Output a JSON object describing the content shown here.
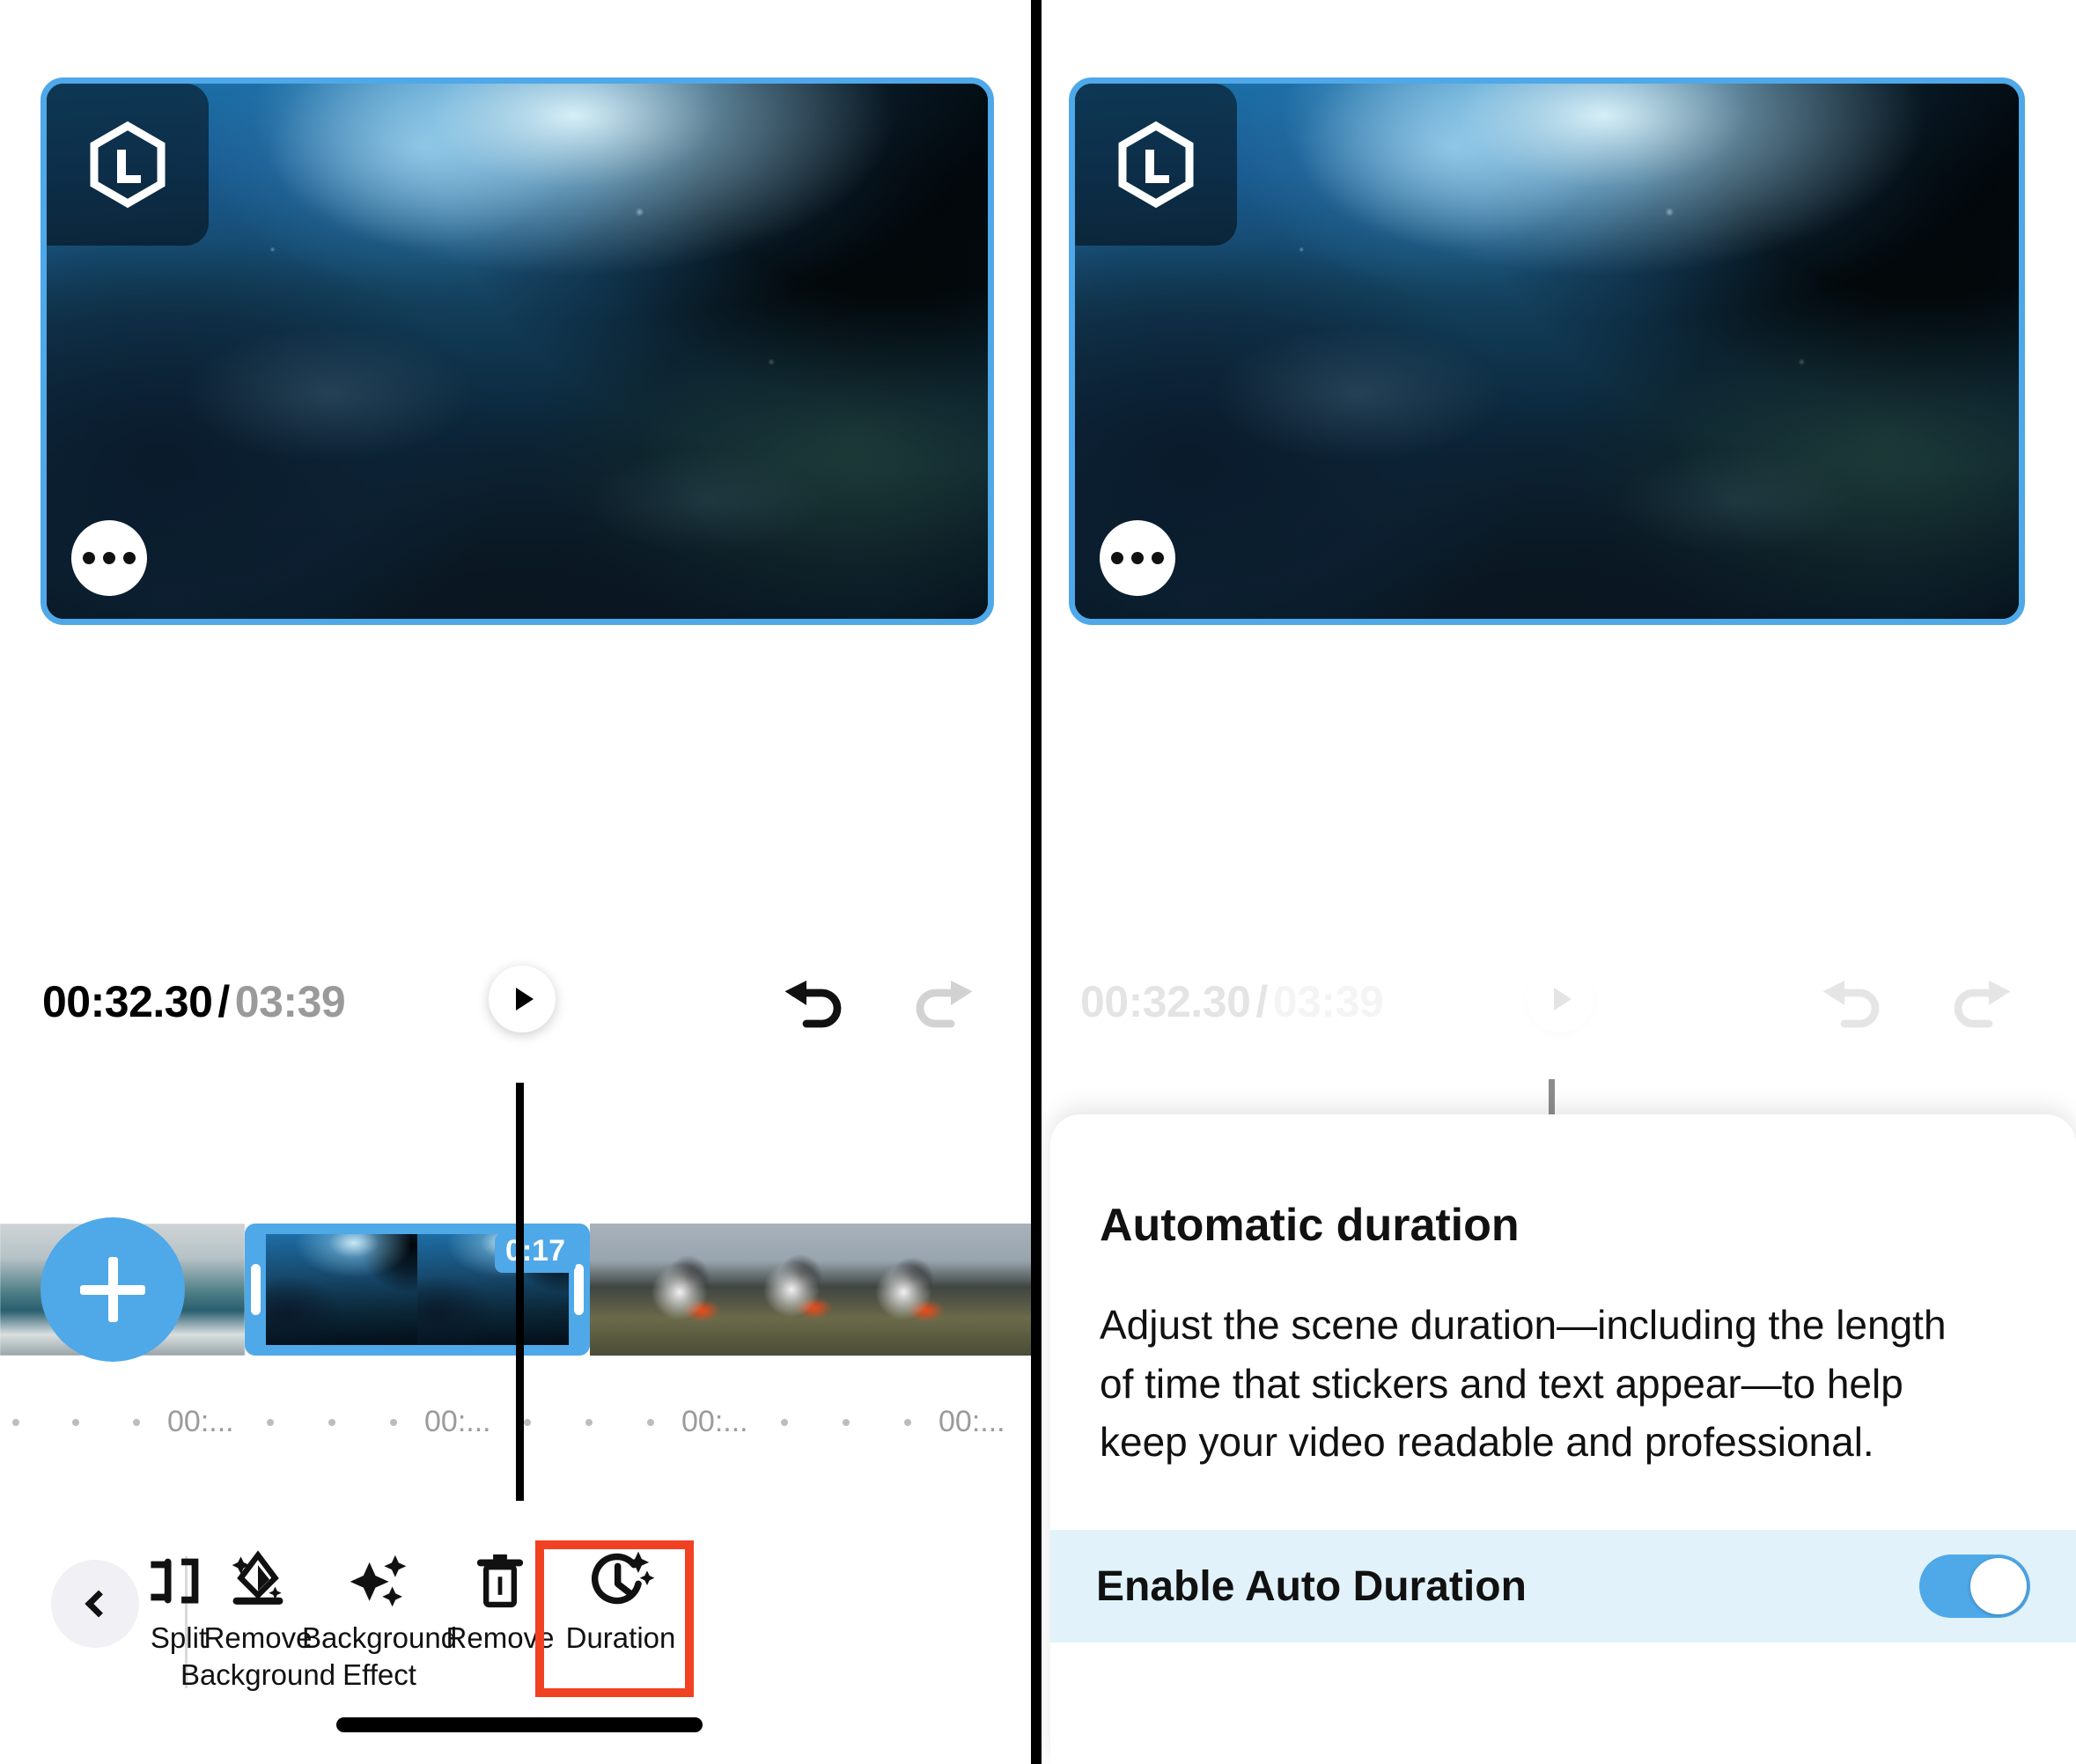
{
  "app": {
    "accent_blue": "#4FA8E8",
    "highlight_red": "#F04123",
    "row_highlight": "#E1F2FB"
  },
  "preview": {
    "watermark_letter": "L",
    "watermark_icon": "hexagon-l-logo",
    "more_icon": "ellipsis-icon"
  },
  "transport": {
    "current_time": "00:32.30",
    "separator": "/",
    "total_time": "03:39",
    "play_icon": "play-icon",
    "undo_icon": "undo-icon",
    "redo_icon": "redo-icon"
  },
  "timeline": {
    "add_label": "+",
    "add_icon": "plus-icon",
    "selected_clip_duration": "0:17",
    "ruler_labels": [
      "00:...",
      "00:...",
      "00:...",
      "00:..."
    ],
    "ruler_ticks": 8
  },
  "toolbar": {
    "back_icon": "chevron-left-icon",
    "items": [
      {
        "label": "Split",
        "icon": "split-icon",
        "highlighted": false
      },
      {
        "label": "Remove\nBackground",
        "line1": "Remove",
        "line2": "Background",
        "icon": "remove-background-icon",
        "highlighted": false
      },
      {
        "label": "Background\nEffect",
        "line1": "Background",
        "line2": "Effect",
        "icon": "background-effect-icon",
        "highlighted": false
      },
      {
        "label": "Remove",
        "line1": "Remove",
        "line2": "",
        "icon": "trash-icon",
        "highlighted": false
      },
      {
        "label": "Duration",
        "line1": "Duration",
        "line2": "",
        "icon": "duration-clock-sparkle-icon",
        "highlighted": true
      }
    ]
  },
  "sheet": {
    "title": "Automatic duration",
    "body": "Adjust the scene duration—including the length of time that stickers and text appear—to help keep your video readable and professional.",
    "toggle_label": "Enable Auto Duration",
    "toggle_state": "on"
  }
}
